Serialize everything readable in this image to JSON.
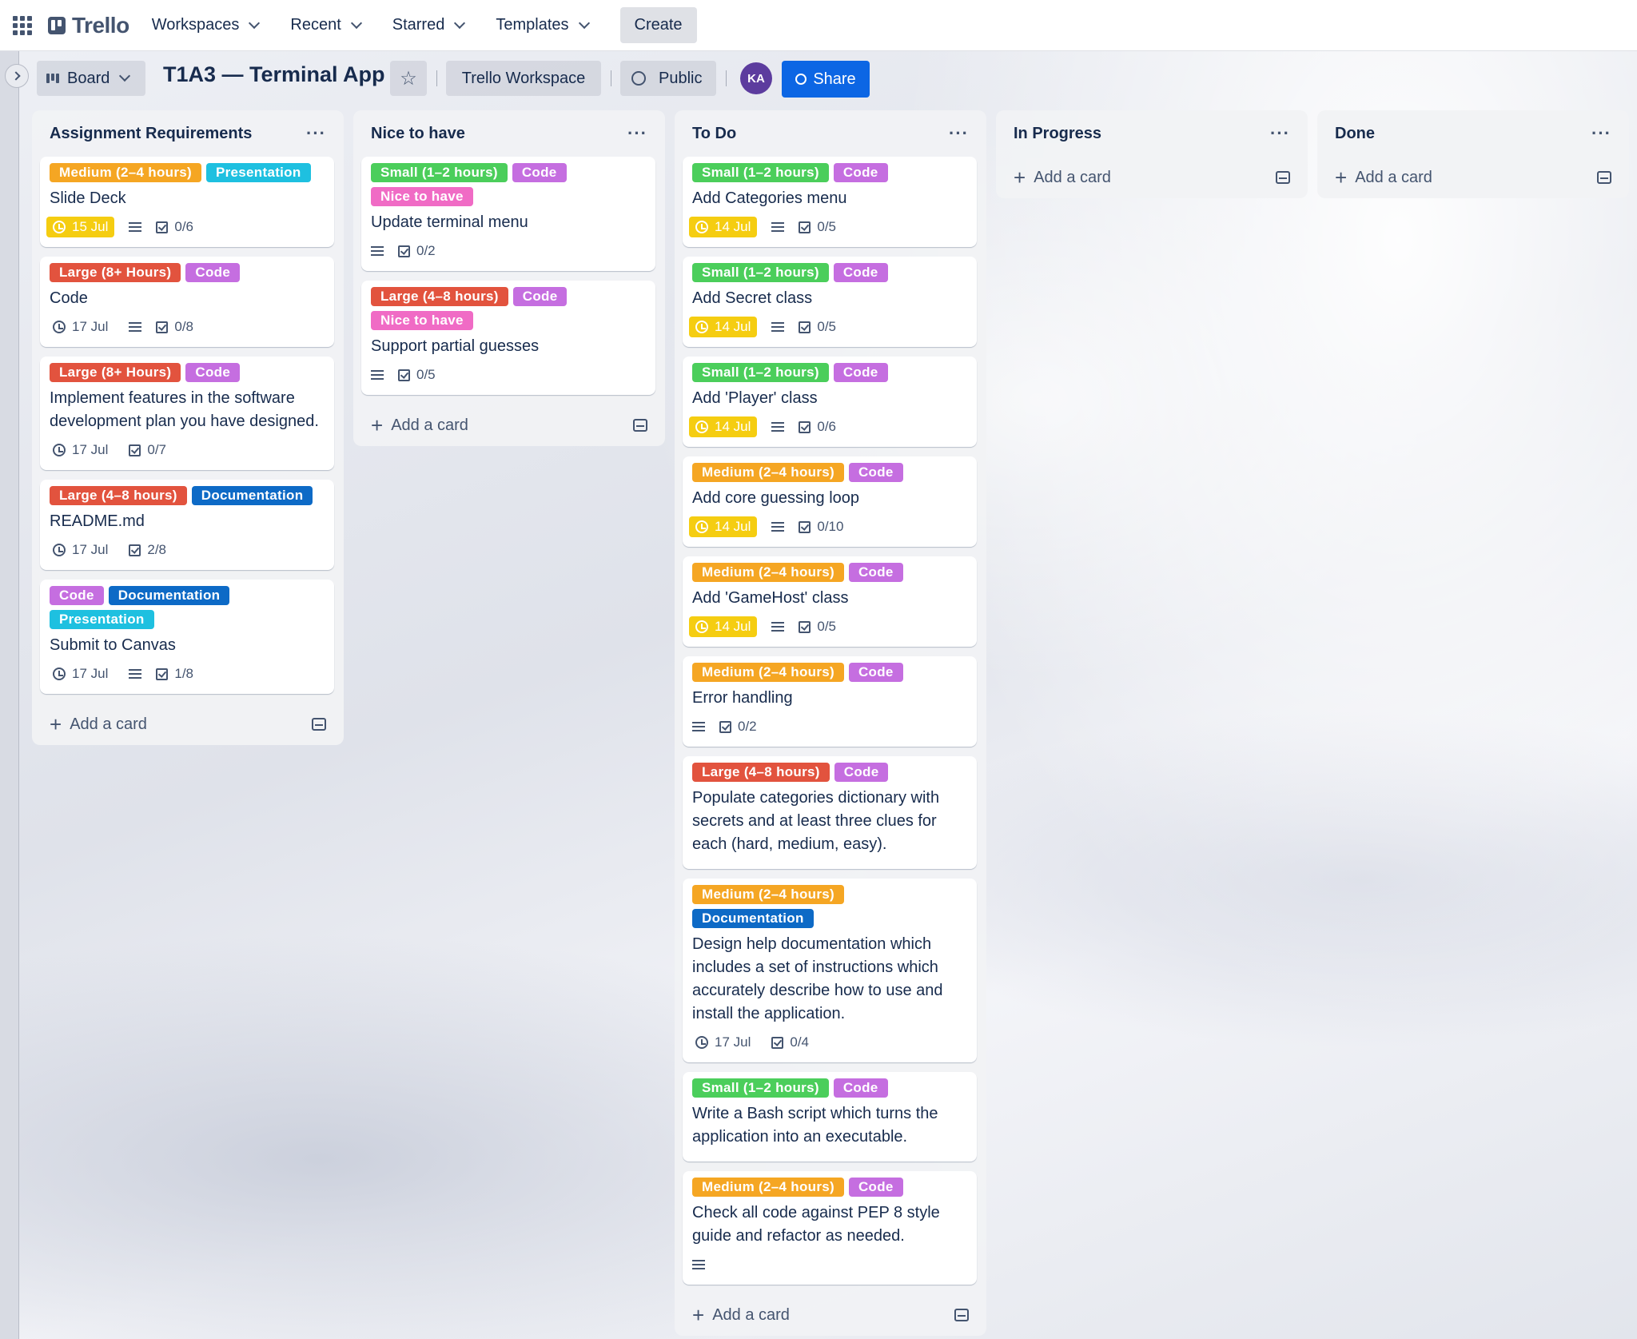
{
  "nav": {
    "logo": "Trello",
    "workspaces": "Workspaces",
    "recent": "Recent",
    "starred": "Starred",
    "templates": "Templates",
    "create": "Create"
  },
  "board": {
    "view": "Board",
    "title": "T1A3 — Terminal App",
    "workspace": "Trello Workspace",
    "visibility": "Public",
    "avatar_initials": "KA",
    "share": "Share"
  },
  "add_card_label": "Add a card",
  "lists": [
    {
      "title": "Assignment Requirements",
      "cards": [
        {
          "labels": [
            {
              "text": "Medium (2–4 hours)",
              "type": "medium"
            },
            {
              "text": "Presentation",
              "type": "presentation"
            }
          ],
          "title": "Slide Deck",
          "due": "15 Jul",
          "due_yellow": true,
          "description": true,
          "checklist": "0/6"
        },
        {
          "labels": [
            {
              "text": "Large (8+ Hours)",
              "type": "large"
            },
            {
              "text": "Code",
              "type": "code"
            }
          ],
          "title": "Code",
          "due": "17 Jul",
          "due_yellow": false,
          "description": true,
          "checklist": "0/8"
        },
        {
          "labels": [
            {
              "text": "Large (8+ Hours)",
              "type": "large"
            },
            {
              "text": "Code",
              "type": "code"
            }
          ],
          "title": "Implement features in the software development plan you have designed.",
          "due": "17 Jul",
          "due_yellow": false,
          "description": false,
          "checklist": "0/7"
        },
        {
          "labels": [
            {
              "text": "Large (4–8 hours)",
              "type": "large"
            },
            {
              "text": "Documentation",
              "type": "documentation"
            }
          ],
          "title": "README.md",
          "due": "17 Jul",
          "due_yellow": false,
          "description": false,
          "checklist": "2/8"
        },
        {
          "labels": [
            {
              "text": "Code",
              "type": "code"
            },
            {
              "text": "Documentation",
              "type": "documentation"
            },
            {
              "text": "Presentation",
              "type": "presentation"
            }
          ],
          "title": "Submit to Canvas",
          "due": "17 Jul",
          "due_yellow": false,
          "description": true,
          "checklist": "1/8"
        }
      ]
    },
    {
      "title": "Nice to have",
      "cards": [
        {
          "labels": [
            {
              "text": "Small (1–2 hours)",
              "type": "small"
            },
            {
              "text": "Code",
              "type": "code"
            },
            {
              "text": "Nice to have",
              "type": "nice"
            }
          ],
          "title": "Update terminal menu",
          "due": null,
          "description": true,
          "checklist": "0/2"
        },
        {
          "labels": [
            {
              "text": "Large (4–8 hours)",
              "type": "large"
            },
            {
              "text": "Code",
              "type": "code"
            },
            {
              "text": "Nice to have",
              "type": "nice"
            }
          ],
          "title": "Support partial guesses",
          "due": null,
          "description": true,
          "checklist": "0/5"
        }
      ]
    },
    {
      "title": "To Do",
      "cards": [
        {
          "labels": [
            {
              "text": "Small (1–2 hours)",
              "type": "small"
            },
            {
              "text": "Code",
              "type": "code"
            }
          ],
          "title": "Add Categories menu",
          "due": "14 Jul",
          "due_yellow": true,
          "description": true,
          "checklist": "0/5"
        },
        {
          "labels": [
            {
              "text": "Small (1–2 hours)",
              "type": "small"
            },
            {
              "text": "Code",
              "type": "code"
            }
          ],
          "title": "Add Secret class",
          "due": "14 Jul",
          "due_yellow": true,
          "description": true,
          "checklist": "0/5"
        },
        {
          "labels": [
            {
              "text": "Small (1–2 hours)",
              "type": "small"
            },
            {
              "text": "Code",
              "type": "code"
            }
          ],
          "title": "Add 'Player' class",
          "due": "14 Jul",
          "due_yellow": true,
          "description": true,
          "checklist": "0/6"
        },
        {
          "labels": [
            {
              "text": "Medium (2–4 hours)",
              "type": "medium"
            },
            {
              "text": "Code",
              "type": "code"
            }
          ],
          "title": "Add core guessing loop",
          "due": "14 Jul",
          "due_yellow": true,
          "description": true,
          "checklist": "0/10"
        },
        {
          "labels": [
            {
              "text": "Medium (2–4 hours)",
              "type": "medium"
            },
            {
              "text": "Code",
              "type": "code"
            }
          ],
          "title": "Add 'GameHost' class",
          "due": "14 Jul",
          "due_yellow": true,
          "description": true,
          "checklist": "0/5"
        },
        {
          "labels": [
            {
              "text": "Medium (2–4 hours)",
              "type": "medium"
            },
            {
              "text": "Code",
              "type": "code"
            }
          ],
          "title": "Error handling",
          "due": null,
          "description": true,
          "checklist": "0/2"
        },
        {
          "labels": [
            {
              "text": "Large (4–8 hours)",
              "type": "large"
            },
            {
              "text": "Code",
              "type": "code"
            }
          ],
          "title": "Populate categories dictionary with secrets and at least three clues for each (hard, medium, easy).",
          "due": null,
          "description": false,
          "checklist": null
        },
        {
          "labels": [
            {
              "text": "Medium (2–4 hours)",
              "type": "medium"
            },
            {
              "text": "Documentation",
              "type": "documentation"
            }
          ],
          "title": "Design help documentation which includes a set of instructions which accurately describe how to use and install the application.",
          "due": "17 Jul",
          "due_yellow": false,
          "description": false,
          "checklist": "0/4"
        },
        {
          "labels": [
            {
              "text": "Small (1–2 hours)",
              "type": "small"
            },
            {
              "text": "Code",
              "type": "code"
            }
          ],
          "title": "Write a Bash script which turns the application into an executable.",
          "due": null,
          "description": false,
          "checklist": null
        },
        {
          "labels": [
            {
              "text": "Medium (2–4 hours)",
              "type": "medium"
            },
            {
              "text": "Code",
              "type": "code"
            }
          ],
          "title": "Check all code against PEP 8 style guide and refactor as needed.",
          "due": null,
          "description": true,
          "checklist": null
        }
      ]
    },
    {
      "title": "In Progress",
      "cards": []
    },
    {
      "title": "Done",
      "cards": []
    }
  ],
  "colors": {
    "medium": "#f5a623",
    "large": "#e2533e",
    "small": "#4bce5b",
    "code": "#c56ee0",
    "presentation": "#1ec0e0",
    "documentation": "#0d6ac6",
    "nice": "#f06bc5",
    "due_yellow": "#f5cd11",
    "share": "#0c66e4",
    "avatar": "#5c3c9e"
  }
}
